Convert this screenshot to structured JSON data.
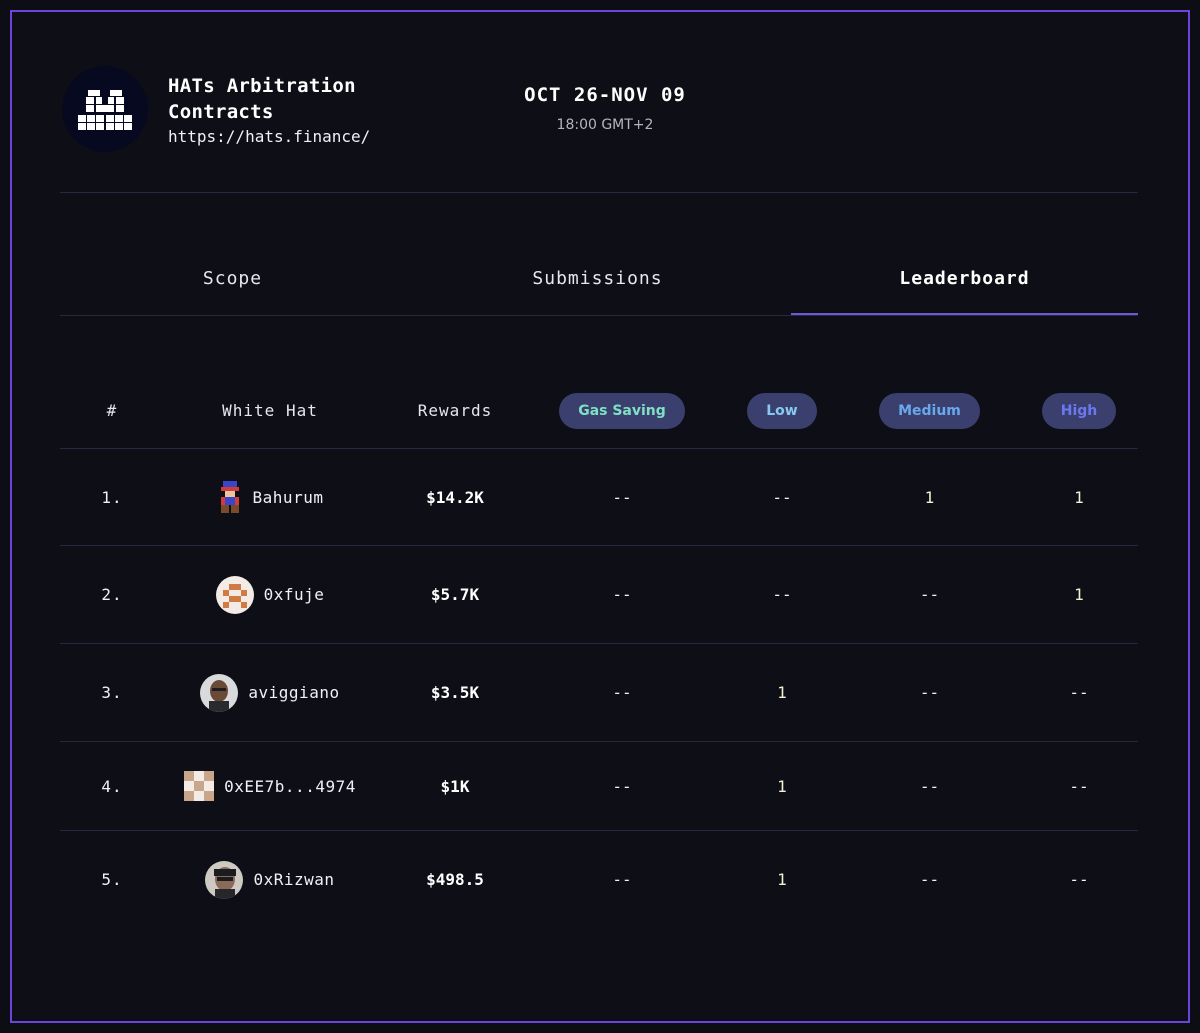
{
  "project": {
    "name": "HATs Arbitration Contracts",
    "url": "https://hats.finance/",
    "dates": "OCT 26-NOV 09",
    "time": "18:00 GMT+2"
  },
  "tabs": [
    {
      "label": "Scope",
      "active": false
    },
    {
      "label": "Submissions",
      "active": false
    },
    {
      "label": "Leaderboard",
      "active": true
    }
  ],
  "leaderboard": {
    "headers": {
      "rank": "#",
      "white_hat": "White Hat",
      "rewards": "Rewards",
      "gas_saving": "Gas Saving",
      "low": "Low",
      "medium": "Medium",
      "high": "High"
    },
    "severity_colors": {
      "gas_saving": "#7fe0c3",
      "low": "#87c9f0",
      "medium": "#6aa8ee",
      "high": "#6b78f2",
      "pill_bg": "#3a3f6e"
    },
    "rows": [
      {
        "rank": "1.",
        "name": "Bahurum",
        "avatar": "pixel-sprite-avatar",
        "rewards": "$14.2K",
        "gas_saving": "--",
        "low": "--",
        "medium": "1",
        "high": "1"
      },
      {
        "rank": "2.",
        "name": "0xfuje",
        "avatar": "pixel-face-avatar",
        "rewards": "$5.7K",
        "gas_saving": "--",
        "low": "--",
        "medium": "--",
        "high": "1"
      },
      {
        "rank": "3.",
        "name": "aviggiano",
        "avatar": "photo-avatar",
        "rewards": "$3.5K",
        "gas_saving": "--",
        "low": "1",
        "medium": "--",
        "high": "--"
      },
      {
        "rank": "4.",
        "name": "0xEE7b...4974",
        "avatar": "identicon-avatar",
        "rewards": "$1K",
        "gas_saving": "--",
        "low": "1",
        "medium": "--",
        "high": "--"
      },
      {
        "rank": "5.",
        "name": "0xRizwan",
        "avatar": "photo-avatar",
        "rewards": "$498.5",
        "gas_saving": "--",
        "low": "1",
        "medium": "--",
        "high": "--"
      }
    ]
  }
}
